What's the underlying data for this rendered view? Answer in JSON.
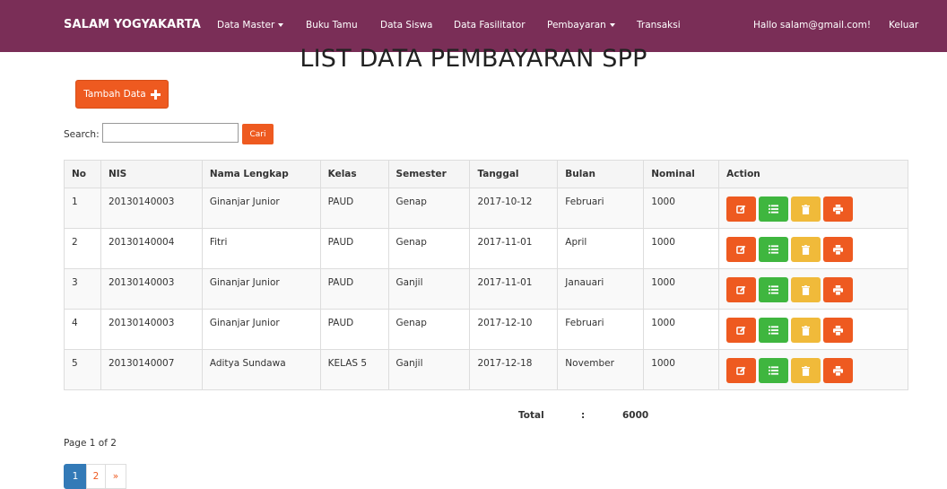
{
  "navbar": {
    "brand": "SALAM YOGYAKARTA",
    "items": [
      {
        "label": "Data Master",
        "dropdown": true
      },
      {
        "label": "Buku Tamu",
        "dropdown": false
      },
      {
        "label": "Data Siswa",
        "dropdown": false
      },
      {
        "label": "Data Fasilitator",
        "dropdown": false
      },
      {
        "label": "Pembayaran",
        "dropdown": true
      },
      {
        "label": "Transaksi",
        "dropdown": false
      }
    ],
    "greeting": "Hallo salam@gmail.com!",
    "logout": "Keluar",
    "background": "#7a2e57"
  },
  "page": {
    "title": "LIST DATA PEMBAYARAN SPP",
    "add_button": "Tambah Data",
    "accent": "#ee5a20"
  },
  "search": {
    "label": "Search:",
    "value": "",
    "button": "Cari"
  },
  "table": {
    "columns": [
      "No",
      "NIS",
      "Nama Lengkap",
      "Kelas",
      "Semester",
      "Tanggal",
      "Bulan",
      "Nominal",
      "Action"
    ],
    "rows": [
      [
        "1",
        "20130140003",
        "Ginanjar Junior",
        "PAUD",
        "Genap",
        "2017-10-12",
        "Februari",
        "1000"
      ],
      [
        "2",
        "20130140004",
        "Fitri",
        "PAUD",
        "Genap",
        "2017-11-01",
        "April",
        "1000"
      ],
      [
        "3",
        "20130140003",
        "Ginanjar Junior",
        "PAUD",
        "Ganjil",
        "2017-11-01",
        "Janauari",
        "1000"
      ],
      [
        "4",
        "20130140003",
        "Ginanjar Junior",
        "PAUD",
        "Genap",
        "2017-12-10",
        "Februari",
        "1000"
      ],
      [
        "5",
        "20130140007",
        "Aditya Sundawa",
        "KELAS 5",
        "Ganjil",
        "2017-12-18",
        "November",
        "1000"
      ]
    ],
    "action_icons": [
      "edit-icon",
      "list-icon",
      "trash-icon",
      "print-icon"
    ],
    "action_colors": [
      "#ee5a20",
      "#3fb63f",
      "#f0ba3a",
      "#ee5a20"
    ]
  },
  "summary": {
    "total_label": "Total",
    "separator": ":",
    "total_value": "6000"
  },
  "pagination": {
    "info": "Page 1 of 2",
    "pages": [
      "1",
      "2"
    ],
    "next": "»",
    "current": "1"
  }
}
